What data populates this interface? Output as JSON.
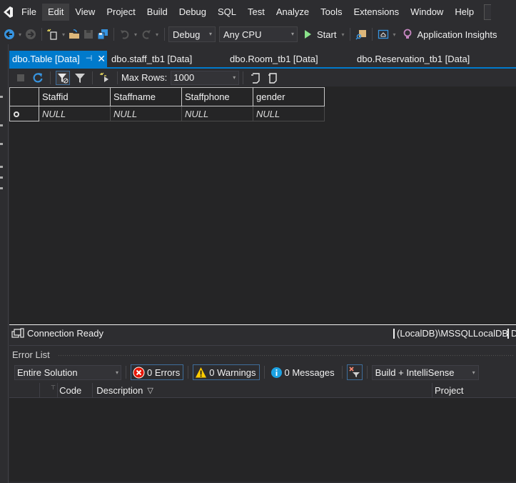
{
  "menu": {
    "items": [
      "File",
      "Edit",
      "View",
      "Project",
      "Build",
      "Debug",
      "SQL",
      "Test",
      "Analyze",
      "Tools",
      "Extensions",
      "Window",
      "Help"
    ],
    "hovered": "Edit"
  },
  "toolbar": {
    "config_value": "Debug",
    "platform_value": "Any CPU",
    "start_label": "Start",
    "insights_label": "Application Insights"
  },
  "doc_tabs": [
    {
      "label": "dbo.Table [Data]",
      "active": true
    },
    {
      "label": "dbo.staff_tb1 [Data]",
      "active": false
    },
    {
      "label": "dbo.Room_tb1 [Data]",
      "active": false
    },
    {
      "label": "dbo.Reservation_tb1 [Data]",
      "active": false
    }
  ],
  "data_toolbar": {
    "max_rows_label": "Max Rows:",
    "max_rows_value": "1000"
  },
  "grid": {
    "columns": [
      "Staffid",
      "Staffname",
      "Staffphone",
      "gender"
    ],
    "rows": [
      [
        "NULL",
        "NULL",
        "NULL",
        "NULL"
      ]
    ]
  },
  "query_status": {
    "connection": "Connection Ready",
    "server": "(LocalDB)\\MSSQLLocalDB",
    "extra": "D"
  },
  "error_list": {
    "title": "Error List",
    "scope": "Entire Solution",
    "errors": "0 Errors",
    "warnings": "0 Warnings",
    "messages": "0 Messages",
    "build_filter": "Build + IntelliSense",
    "columns": {
      "code": "Code",
      "description": "Description",
      "project": "Project"
    }
  },
  "colors": {
    "accent": "#007acc",
    "background": "#2d2d30",
    "grid_bg": "#252526",
    "start_green": "#8ae28a"
  }
}
